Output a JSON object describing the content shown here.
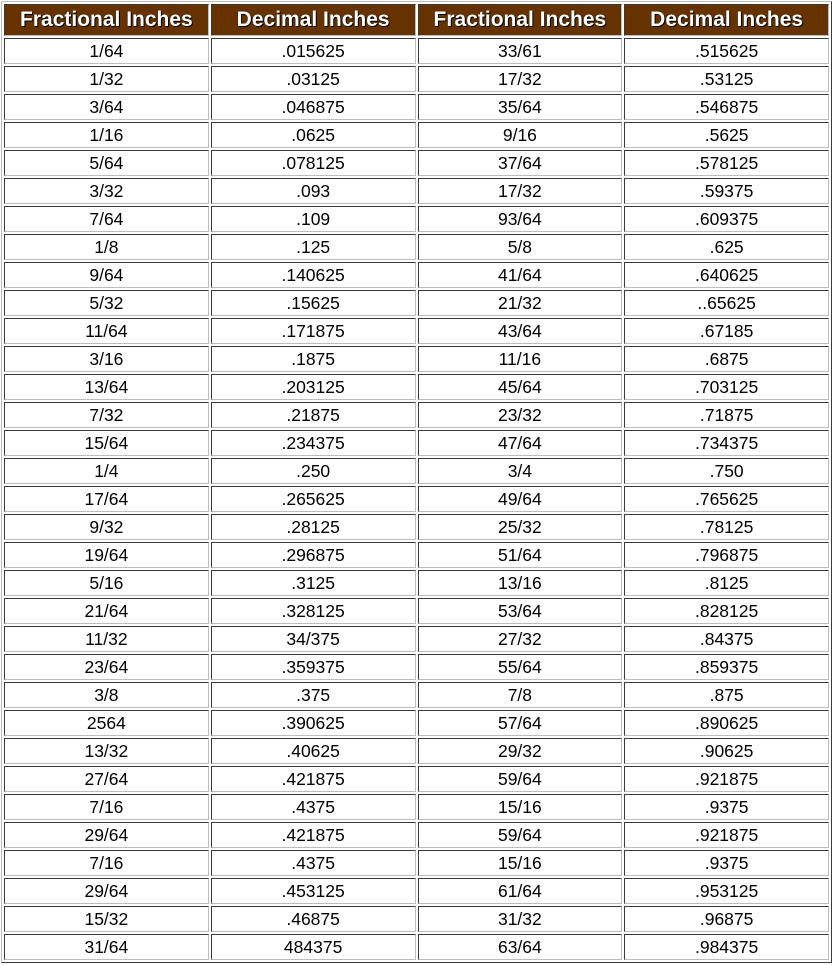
{
  "table": {
    "header_color": "#663300",
    "header_text_color": "#ffffff",
    "headers": [
      "Fractional Inches",
      "Decimal Inches",
      "Fractional Inches",
      "Decimal Inches"
    ],
    "rows": [
      [
        "1/64",
        ".015625",
        "33/61",
        ".515625"
      ],
      [
        "1/32",
        ".03125",
        "17/32",
        ".53125"
      ],
      [
        "3/64",
        ".046875",
        "35/64",
        ".546875"
      ],
      [
        "1/16",
        ".0625",
        "9/16",
        ".5625"
      ],
      [
        "5/64",
        ".078125",
        "37/64",
        ".578125"
      ],
      [
        "3/32",
        ".093",
        "17/32",
        ".59375"
      ],
      [
        "7/64",
        ".109",
        "93/64",
        ".609375"
      ],
      [
        "1/8",
        ".125",
        "5/8",
        ".625"
      ],
      [
        "9/64",
        ".140625",
        "41/64",
        ".640625"
      ],
      [
        "5/32",
        ".15625",
        "21/32",
        "..65625"
      ],
      [
        "11/64",
        ".171875",
        "43/64",
        ".67185"
      ],
      [
        "3/16",
        ".1875",
        "11/16",
        ".6875"
      ],
      [
        "13/64",
        ".203125",
        "45/64",
        ".703125"
      ],
      [
        "7/32",
        ".21875",
        "23/32",
        ".71875"
      ],
      [
        "15/64",
        ".234375",
        "47/64",
        ".734375"
      ],
      [
        "1/4",
        ".250",
        "3/4",
        ".750"
      ],
      [
        "17/64",
        ".265625",
        "49/64",
        ".765625"
      ],
      [
        "9/32",
        ".28125",
        "25/32",
        ".78125"
      ],
      [
        "19/64",
        ".296875",
        "51/64",
        ".796875"
      ],
      [
        "5/16",
        ".3125",
        "13/16",
        ".8125"
      ],
      [
        "21/64",
        ".328125",
        "53/64",
        ".828125"
      ],
      [
        "11/32",
        "34/375",
        "27/32",
        ".84375"
      ],
      [
        "23/64",
        ".359375",
        "55/64",
        ".859375"
      ],
      [
        "3/8",
        ".375",
        "7/8",
        ".875"
      ],
      [
        "2564",
        ".390625",
        "57/64",
        ".890625"
      ],
      [
        "13/32",
        ".40625",
        "29/32",
        ".90625"
      ],
      [
        "27/64",
        ".421875",
        "59/64",
        ".921875"
      ],
      [
        "7/16",
        ".4375",
        "15/16",
        ".9375"
      ],
      [
        "29/64",
        ".421875",
        "59/64",
        ".921875"
      ],
      [
        "7/16",
        ".4375",
        "15/16",
        ".9375"
      ],
      [
        "29/64",
        ".453125",
        "61/64",
        ".953125"
      ],
      [
        "15/32",
        ".46875",
        "31/32",
        ".96875"
      ],
      [
        "31/64",
        "484375",
        "63/64",
        ".984375"
      ]
    ]
  }
}
